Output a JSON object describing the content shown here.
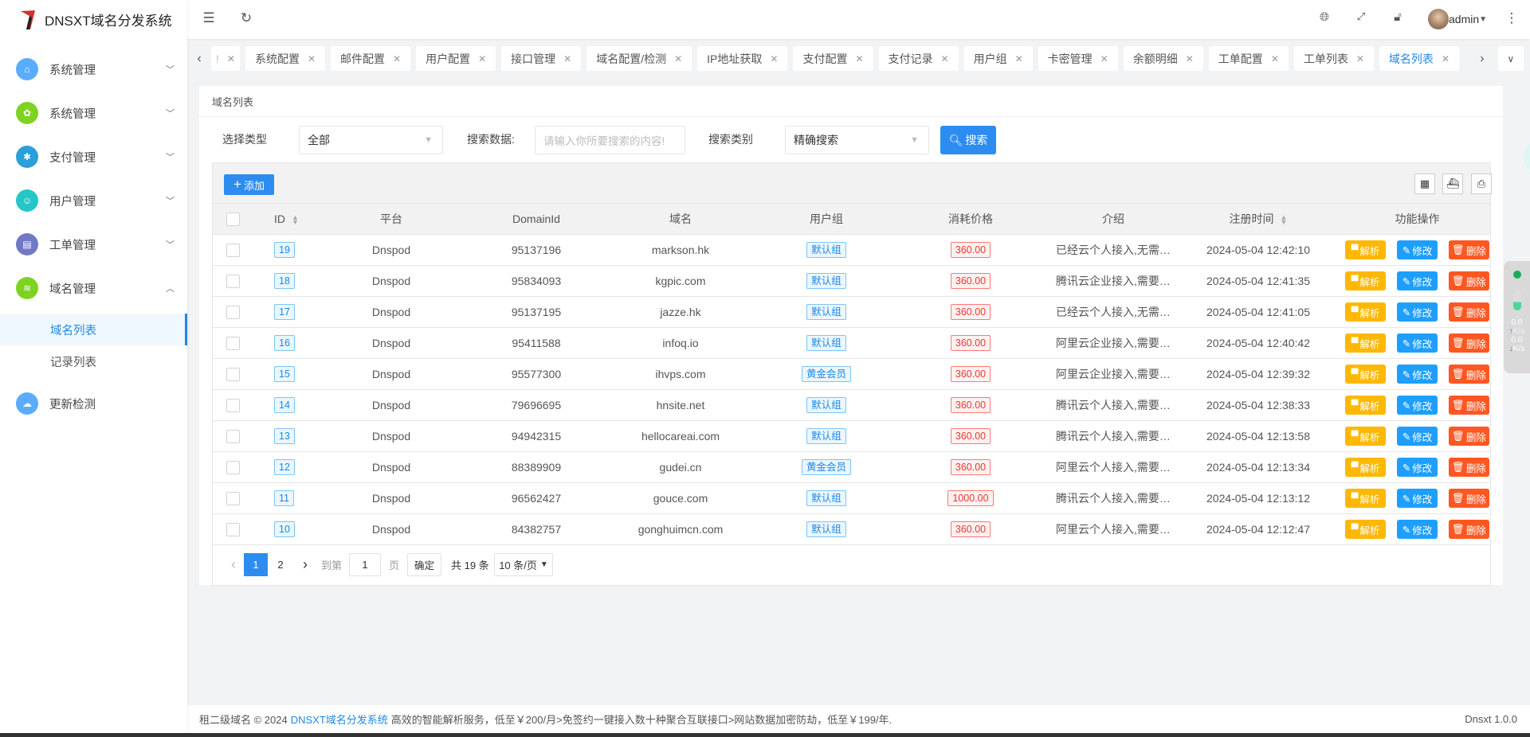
{
  "app": {
    "title": "DNSXT域名分发系统"
  },
  "header": {
    "user": "admin",
    "icons": [
      "menu-fold-icon",
      "refresh-icon",
      "globe-icon",
      "fullscreen-icon",
      "lock-icon",
      "more-vertical-icon"
    ]
  },
  "sidebar": {
    "items": [
      {
        "label": "系统管理",
        "icon": "home-icon",
        "color": "#5AACFF",
        "expanded": false
      },
      {
        "label": "系统管理",
        "icon": "gear-icon",
        "color": "#7ED321",
        "expanded": false
      },
      {
        "label": "支付管理",
        "icon": "payment-icon",
        "color": "#2A9FD8",
        "expanded": false
      },
      {
        "label": "用户管理",
        "icon": "user-icon",
        "color": "#26C6C6",
        "expanded": false
      },
      {
        "label": "工单管理",
        "icon": "clipboard-icon",
        "color": "#7179C6",
        "expanded": false
      },
      {
        "label": "域名管理",
        "icon": "layers-icon",
        "color": "#7ED321",
        "expanded": true,
        "children": [
          {
            "label": "域名列表",
            "active": true
          },
          {
            "label": "记录列表",
            "active": false
          }
        ]
      },
      {
        "label": "更新检测",
        "icon": "cloud-upload-icon",
        "color": "#5AACFF"
      }
    ]
  },
  "tabs": {
    "partial": "!",
    "items": [
      "系统配置",
      "邮件配置",
      "用户配置",
      "接口管理",
      "域名配置/检测",
      "IP地址获取",
      "支付配置",
      "支付记录",
      "用户组",
      "卡密管理",
      "余额明细",
      "工单配置",
      "工单列表",
      "域名列表"
    ],
    "active": "域名列表",
    "close": "✕"
  },
  "breadcrumb": "域名列表",
  "filters": {
    "type_label": "选择类型",
    "type_value": "全部",
    "search_label": "搜索数据:",
    "search_placeholder": "请输入你所要搜索的内容!",
    "mode_label": "搜索类别",
    "mode_value": "精确搜索",
    "search_button": "搜索"
  },
  "toolbar": {
    "add_button": "添加",
    "icons": [
      "columns-icon",
      "export-icon",
      "print-icon"
    ]
  },
  "table": {
    "columns": [
      "ID",
      "平台",
      "DomainId",
      "域名",
      "用户组",
      "消耗价格",
      "介绍",
      "注册时间",
      "功能操作"
    ],
    "actions": [
      "解析",
      "修改",
      "删除"
    ],
    "rows": [
      {
        "id": "19",
        "platform": "Dnspod",
        "domainId": "95137196",
        "domain": "markson.hk",
        "group": "默认组",
        "price": "360.00",
        "intro": "已经云个人接入,无需…",
        "time": "2024-05-04 12:42:10"
      },
      {
        "id": "18",
        "platform": "Dnspod",
        "domainId": "95834093",
        "domain": "kgpic.com",
        "group": "默认组",
        "price": "360.00",
        "intro": "腾讯云企业接入,需要…",
        "time": "2024-05-04 12:41:35"
      },
      {
        "id": "17",
        "platform": "Dnspod",
        "domainId": "95137195",
        "domain": "jazze.hk",
        "group": "默认组",
        "price": "360.00",
        "intro": "已经云个人接入,无需…",
        "time": "2024-05-04 12:41:05"
      },
      {
        "id": "16",
        "platform": "Dnspod",
        "domainId": "95411588",
        "domain": "infoq.io",
        "group": "默认组",
        "price": "360.00",
        "intro": "阿里云企业接入,需要…",
        "time": "2024-05-04 12:40:42"
      },
      {
        "id": "15",
        "platform": "Dnspod",
        "domainId": "95577300",
        "domain": "ihvps.com",
        "group": "黄金会员",
        "price": "360.00",
        "intro": "阿里云企业接入,需要…",
        "time": "2024-05-04 12:39:32"
      },
      {
        "id": "14",
        "platform": "Dnspod",
        "domainId": "79696695",
        "domain": "hnsite.net",
        "group": "默认组",
        "price": "360.00",
        "intro": "腾讯云个人接入,需要…",
        "time": "2024-05-04 12:38:33"
      },
      {
        "id": "13",
        "platform": "Dnspod",
        "domainId": "94942315",
        "domain": "hellocareai.com",
        "group": "默认组",
        "price": "360.00",
        "intro": "腾讯云个人接入,需要…",
        "time": "2024-05-04 12:13:58"
      },
      {
        "id": "12",
        "platform": "Dnspod",
        "domainId": "88389909",
        "domain": "gudei.cn",
        "group": "黄金会员",
        "price": "360.00",
        "intro": "阿里云个人接入,需要…",
        "time": "2024-05-04 12:13:34"
      },
      {
        "id": "11",
        "platform": "Dnspod",
        "domainId": "96562427",
        "domain": "gouce.com",
        "group": "默认组",
        "price": "1000.00",
        "intro": "腾讯云个人接入,需要…",
        "time": "2024-05-04 12:13:12"
      },
      {
        "id": "10",
        "platform": "Dnspod",
        "domainId": "84382757",
        "domain": "gonghuimcn.com",
        "group": "默认组",
        "price": "360.00",
        "intro": "阿里云个人接入,需要…",
        "time": "2024-05-04 12:12:47"
      }
    ]
  },
  "pagination": {
    "current": "1",
    "pages": [
      "1",
      "2"
    ],
    "goto_label": "到第",
    "goto_value": "1",
    "page_unit": "页",
    "confirm": "确定",
    "total": "共 19 条",
    "page_size": "10 条/页"
  },
  "footer": {
    "prefix": "租二级域名 © 2024",
    "link": "DNSXT域名分发系统",
    "suffix": "高效的智能解析服务，低至￥200/月>免签约一键接入数十种聚合互联接口>网站数据加密防劫，低至￥199/年.",
    "version": "Dnsxt 1.0.0"
  },
  "net_widget": {
    "up": "0.0",
    "down": "0.0",
    "unit": "K/s"
  },
  "colors": {
    "primary": "#2d8cf0",
    "parse": "#FFB800",
    "edit": "#1E9FFF",
    "delete": "#FF5722"
  }
}
